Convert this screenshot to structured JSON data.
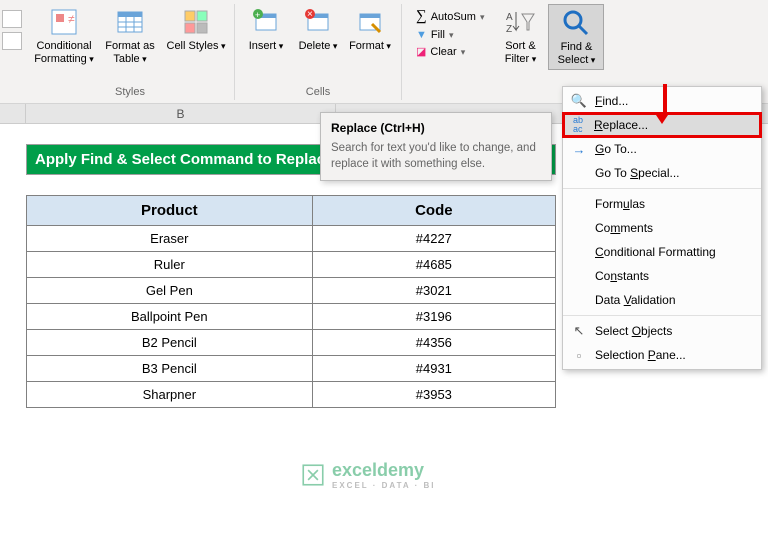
{
  "ribbon": {
    "groups": {
      "styles": {
        "label": "Styles",
        "cond_fmt": "Conditional Formatting",
        "fmt_table": "Format as Table",
        "cell_styles": "Cell Styles"
      },
      "cells": {
        "label": "Cells",
        "insert": "Insert",
        "delete": "Delete",
        "format": "Format"
      },
      "editing_mini": {
        "autosum": "AutoSum",
        "fill": "Fill",
        "clear": "Clear"
      },
      "sort": {
        "label": "Sort & Filter"
      },
      "find": {
        "label": "Find & Select"
      }
    }
  },
  "tooltip": {
    "title": "Replace (Ctrl+H)",
    "desc": "Search for text you'd like to change, and replace it with something else."
  },
  "menu": {
    "find": "Find...",
    "replace": "Replace...",
    "goto": "Go To...",
    "goto_special": "Go To Special...",
    "formulas": "Formulas",
    "comments": "Comments",
    "cond_fmt": "Conditional Formatting",
    "constants": "Constants",
    "data_val": "Data Validation",
    "sel_obj": "Select Objects",
    "sel_pane": "Selection Pane..."
  },
  "sheet": {
    "col_b": "B",
    "banner": "Apply Find & Select Command to Replace Special Characters",
    "headers": {
      "product": "Product",
      "code": "Code"
    },
    "rows": [
      {
        "product": "Eraser",
        "code": "#4227"
      },
      {
        "product": "Ruler",
        "code": "#4685"
      },
      {
        "product": "Gel Pen",
        "code": "#3021"
      },
      {
        "product": "Ballpoint Pen",
        "code": "#3196"
      },
      {
        "product": "B2 Pencil",
        "code": "#4356"
      },
      {
        "product": "B3 Pencil",
        "code": "#4931"
      },
      {
        "product": "Sharpner",
        "code": "#3953"
      }
    ]
  },
  "watermark": {
    "brand": "exceldemy",
    "tagline": "EXCEL · DATA · BI"
  }
}
